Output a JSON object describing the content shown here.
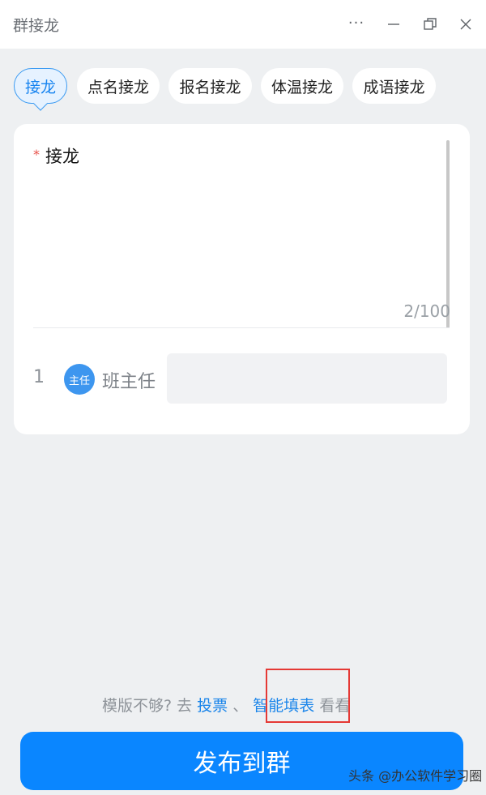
{
  "window": {
    "title": "群接龙",
    "more_label": "···"
  },
  "tabs": [
    {
      "label": "接龙",
      "active": true
    },
    {
      "label": "点名接龙",
      "active": false
    },
    {
      "label": "报名接龙",
      "active": false
    },
    {
      "label": "体温接龙",
      "active": false
    },
    {
      "label": "成语接龙",
      "active": false
    }
  ],
  "card": {
    "required_mark": "*",
    "title": "接龙",
    "counter": "2/100",
    "row": {
      "index": "1",
      "avatar_text": "主任",
      "name": "班主任",
      "input_value": ""
    }
  },
  "footer": {
    "hint_prefix": "模版不够? 去",
    "link_vote": "投票",
    "separator": "、",
    "link_form": "智能填表",
    "hint_suffix": "看看",
    "publish_label": "发布到群",
    "watermark": "头条 @办公软件学习圈"
  },
  "colors": {
    "accent": "#0a86ff",
    "link": "#1a85ea",
    "highlight": "#e53935",
    "required": "#e8514a"
  }
}
